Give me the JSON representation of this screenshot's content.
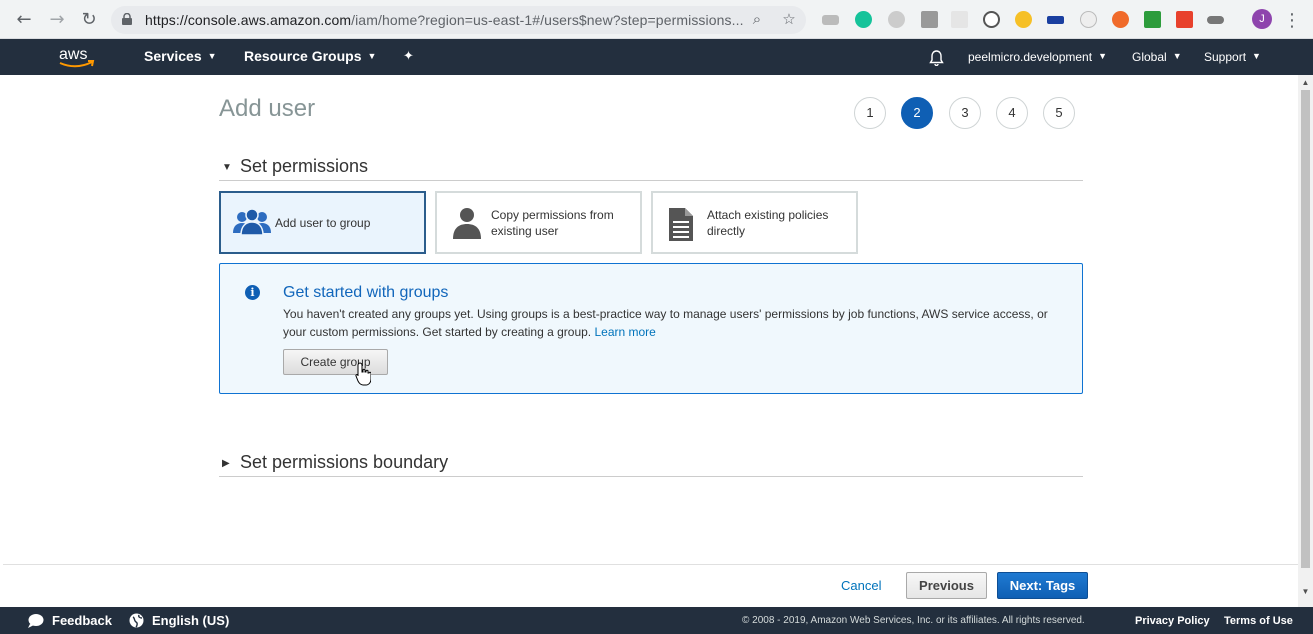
{
  "browser": {
    "url_main": "https://console.aws.amazon.com",
    "url_rest": "/iam/home?region=us-east-1#/users$new?step=permissions...",
    "avatar_letter": "J"
  },
  "nav": {
    "services": "Services",
    "resource_groups": "Resource Groups",
    "account": "peelmicro.development",
    "region": "Global",
    "support": "Support"
  },
  "page": {
    "title": "Add user",
    "steps": [
      "1",
      "2",
      "3",
      "4",
      "5"
    ],
    "active_step": 2
  },
  "permissions": {
    "heading": "Set permissions",
    "options": [
      {
        "label_line1": "Add user to group",
        "label_line2": "",
        "selected": true,
        "icon": "users-group-icon"
      },
      {
        "label_line1": "Copy permissions from",
        "label_line2": "existing user",
        "selected": false,
        "icon": "user-icon"
      },
      {
        "label_line1": "Attach existing policies",
        "label_line2": "directly",
        "selected": false,
        "icon": "document-icon"
      }
    ]
  },
  "info": {
    "title": "Get started with groups",
    "text": "You haven't created any groups yet. Using groups is a best-practice way to manage users' permissions by job functions, AWS service access, or your custom permissions. Get started by creating a group.",
    "learn_more": "Learn more",
    "create_group": "Create group"
  },
  "boundary": {
    "heading": "Set permissions boundary"
  },
  "actions": {
    "cancel": "Cancel",
    "previous": "Previous",
    "next": "Next: Tags"
  },
  "footer": {
    "feedback": "Feedback",
    "language": "English (US)",
    "copyright": "© 2008 - 2019, Amazon Web Services, Inc. or its affiliates. All rights reserved.",
    "privacy": "Privacy Policy",
    "terms": "Terms of Use"
  },
  "colors": {
    "aws_nav": "#232f3e",
    "primary_blue": "#0f5fb4",
    "link_blue": "#0073bb",
    "info_bg": "#f0f8fd",
    "aws_orange": "#ff9900"
  }
}
